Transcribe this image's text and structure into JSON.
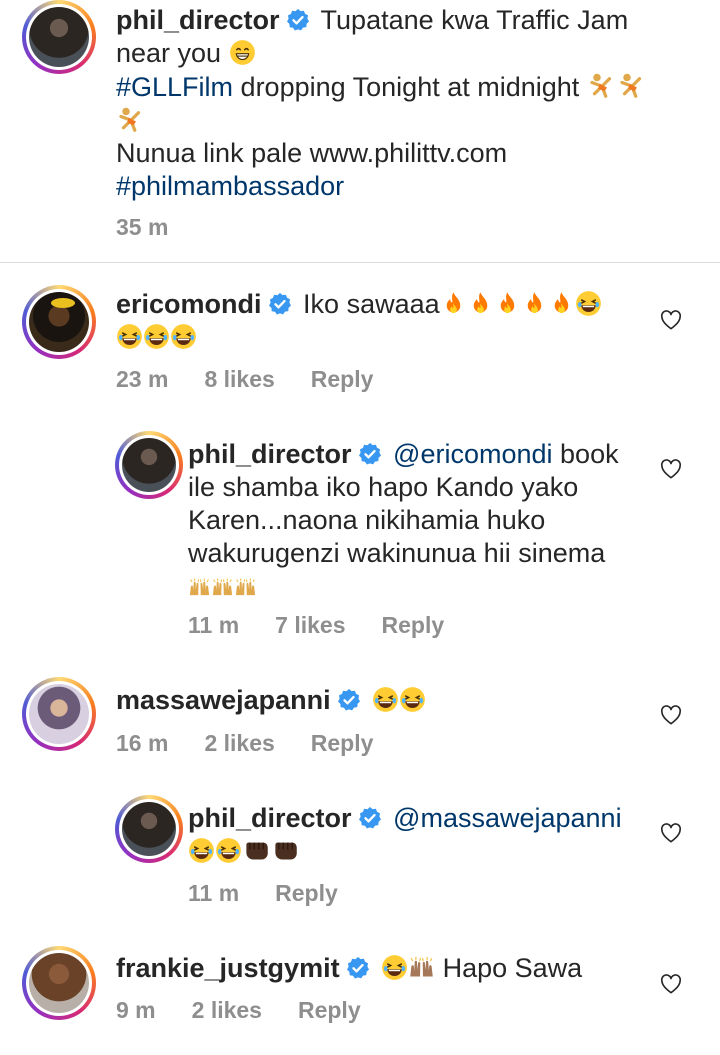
{
  "post": {
    "username": "phil_director",
    "line1": "Tupatane kwa Traffic Jam",
    "line2": "near you",
    "hashtag1": "#GLLFilm",
    "line3": "dropping Tonight at midnight",
    "line4": "Nunua link pale www.philittv.com",
    "hashtag2": "#philmambassador",
    "time": "35 m"
  },
  "comments": [
    {
      "username": "ericomondi",
      "text": "Iko sawaaa",
      "time": "23 m",
      "likes": "8 likes",
      "reply": "Reply"
    },
    {
      "username": "phil_director",
      "mention": "@ericomondi",
      "text1": "book",
      "text2": "ile shamba iko hapo Kando yako",
      "text3": "Karen...naona nikihamia huko",
      "text4": "wakurugenzi wakinunua hii sinema",
      "time": "11 m",
      "likes": "7 likes",
      "reply": "Reply"
    },
    {
      "username": "massawejapanni",
      "time": "16 m",
      "likes": "2 likes",
      "reply": "Reply"
    },
    {
      "username": "phil_director",
      "mention": "@massawejapanni",
      "time": "11 m",
      "reply": "Reply"
    },
    {
      "username": "frankie_justgymit",
      "text": "Hapo Sawa",
      "time": "9 m",
      "likes": "2 likes",
      "reply": "Reply"
    }
  ],
  "icons": {
    "verified": "verified-badge-icon",
    "heart": "heart-outline-icon",
    "fire": "fire-emoji",
    "laugh": "laughing-emoji",
    "hands": "raised-hands-emoji",
    "fist": "fist-bump-emoji",
    "cartwheel": "cartwheel-emoji",
    "grin": "grinning-emoji"
  },
  "colors": {
    "verified": "#3897f0",
    "link": "#00376b",
    "meta": "#8e8e8e"
  }
}
